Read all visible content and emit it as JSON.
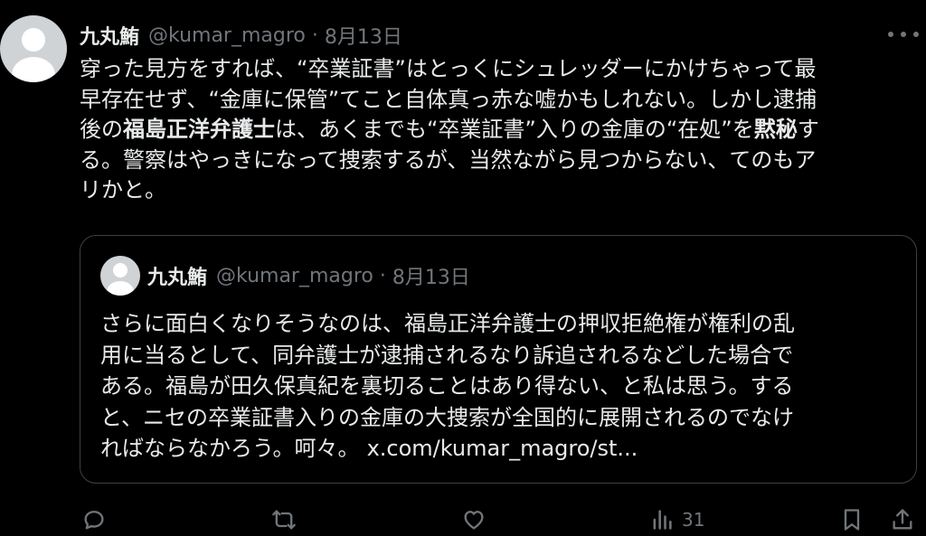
{
  "tweet": {
    "author_name": "九丸鮪",
    "handle": "@kumar_magro",
    "separator": "·",
    "date": "8月13日",
    "more_icon": "more-horizontal-icon",
    "lines": [
      {
        "before": "穿った見方をすれば、“卒業証書”はとっくにシュレッダーにかけちゃって最",
        "bold": "",
        "after": "",
        "bold2": "",
        "after2": ""
      },
      {
        "before": "早存在せず、“金庫に保管”てこと自体真っ赤な嘘かもしれない。しかし逮捕",
        "bold": "",
        "after": "",
        "bold2": "",
        "after2": ""
      },
      {
        "before": "後の",
        "bold": "福島正洋弁護士",
        "after": "は、あくまでも“卒業証書”入りの金庫の“在処”を",
        "bold2": "黙秘",
        "after2": "す"
      },
      {
        "before": "る。警察はやっきになって捜索するが、当然ながら見つからない、てのもア",
        "bold": "",
        "after": "",
        "bold2": "",
        "after2": ""
      },
      {
        "before": "リかと。",
        "bold": "",
        "after": "",
        "bold2": "",
        "after2": ""
      }
    ]
  },
  "quote": {
    "author_name": "九丸鮪",
    "handle": "@kumar_magro",
    "separator": "·",
    "date": "8月13日",
    "lines": [
      "さらに面白くなりそうなのは、福島正洋弁護士の押収拒絶権が権利の乱",
      "用に当るとして、同弁護士が逮捕されるなり訴追されるなどした場合で",
      "ある。福島が田久保真紀を裏切ることはあり得ない、と私は思う。する",
      "と、ニセの卒業証書入りの金庫の大捜索が全国的に展開されるのでなけ"
    ],
    "last_line": "ればならなかろう。呵々。",
    "link": "x.com/kumar_magro/st..."
  },
  "actions": {
    "reply_icon": "reply-icon",
    "repost_icon": "repost-icon",
    "like_icon": "like-icon",
    "views_icon": "views-icon",
    "views_count": "31",
    "bookmark_icon": "bookmark-icon",
    "share_icon": "share-icon"
  },
  "colors": {
    "background": "#000000",
    "text": "#e7e9ea",
    "secondary": "#71767b",
    "border": "#3e4144"
  }
}
